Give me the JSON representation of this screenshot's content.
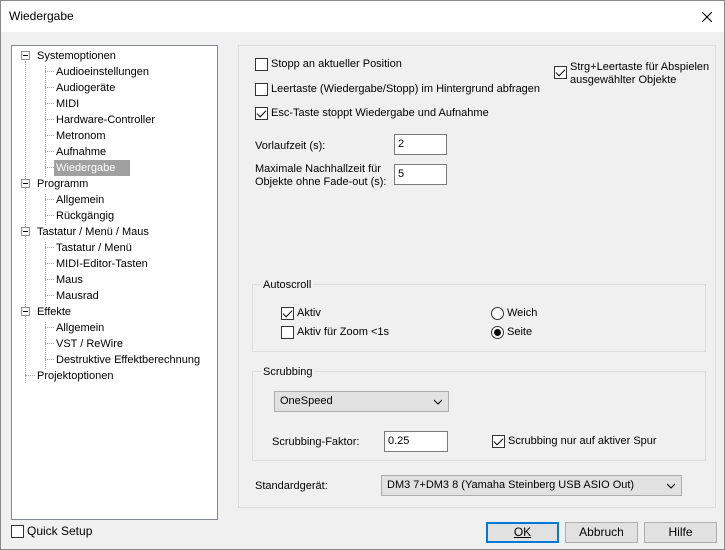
{
  "window": {
    "title": "Wiedergabe"
  },
  "tree": {
    "items": [
      {
        "label": "Systemoptionen"
      },
      {
        "label": "Audioeinstellungen"
      },
      {
        "label": "Audiogeräte"
      },
      {
        "label": "MIDI"
      },
      {
        "label": "Hardware-Controller"
      },
      {
        "label": "Metronom"
      },
      {
        "label": "Aufnahme"
      },
      {
        "label": "Wiedergabe"
      },
      {
        "label": "Programm"
      },
      {
        "label": "Allgemein"
      },
      {
        "label": "Rückgängig"
      },
      {
        "label": "Tastatur / Menü / Maus"
      },
      {
        "label": "Tastatur / Menü"
      },
      {
        "label": "MIDI-Editor-Tasten"
      },
      {
        "label": "Maus"
      },
      {
        "label": "Mausrad"
      },
      {
        "label": "Effekte"
      },
      {
        "label": "Allgemein"
      },
      {
        "label": "VST / ReWire"
      },
      {
        "label": "Destruktive Effektberechnung"
      },
      {
        "label": "Projektoptionen"
      }
    ],
    "selected": "Wiedergabe"
  },
  "options": {
    "stop_at_position": {
      "label": "Stopp an aktueller Position",
      "checked": false
    },
    "space_background": {
      "label": "Leertaste (Wiedergabe/Stopp) im Hintergrund abfragen",
      "checked": false
    },
    "esc_stops": {
      "label": "Esc-Taste stoppt Wiedergabe und Aufnahme",
      "checked": true
    },
    "ctrl_space": {
      "label_line1": "Strg+Leertaste für Abspielen",
      "label_line2": "ausgewählter Objekte",
      "checked": true
    }
  },
  "preroll": {
    "label": "Vorlaufzeit (s):",
    "value": "2"
  },
  "postroll": {
    "label_line1": "Maximale Nachhallzeit für",
    "label_line2": "Objekte ohne Fade-out (s):",
    "value": "5"
  },
  "autoscroll": {
    "title": "Autoscroll",
    "active": {
      "label": "Aktiv",
      "checked": true
    },
    "zoom": {
      "label": "Aktiv für Zoom <1s",
      "checked": false
    },
    "soft": {
      "label": "Weich",
      "checked": false
    },
    "page": {
      "label": "Seite",
      "checked": true
    }
  },
  "scrubbing": {
    "title": "Scrubbing",
    "mode": "OneSpeed",
    "factor_label": "Scrubbing-Faktor:",
    "factor_value": "0.25",
    "active_track": {
      "label": "Scrubbing nur auf aktiver Spur",
      "checked": true
    }
  },
  "device": {
    "label": "Standardgerät:",
    "value": "DM3 7+DM3 8 (Yamaha Steinberg USB ASIO Out)"
  },
  "footer": {
    "quick_setup": {
      "label": "Quick Setup",
      "checked": false
    },
    "ok": "OK",
    "cancel": "Abbruch",
    "help": "Hilfe"
  }
}
